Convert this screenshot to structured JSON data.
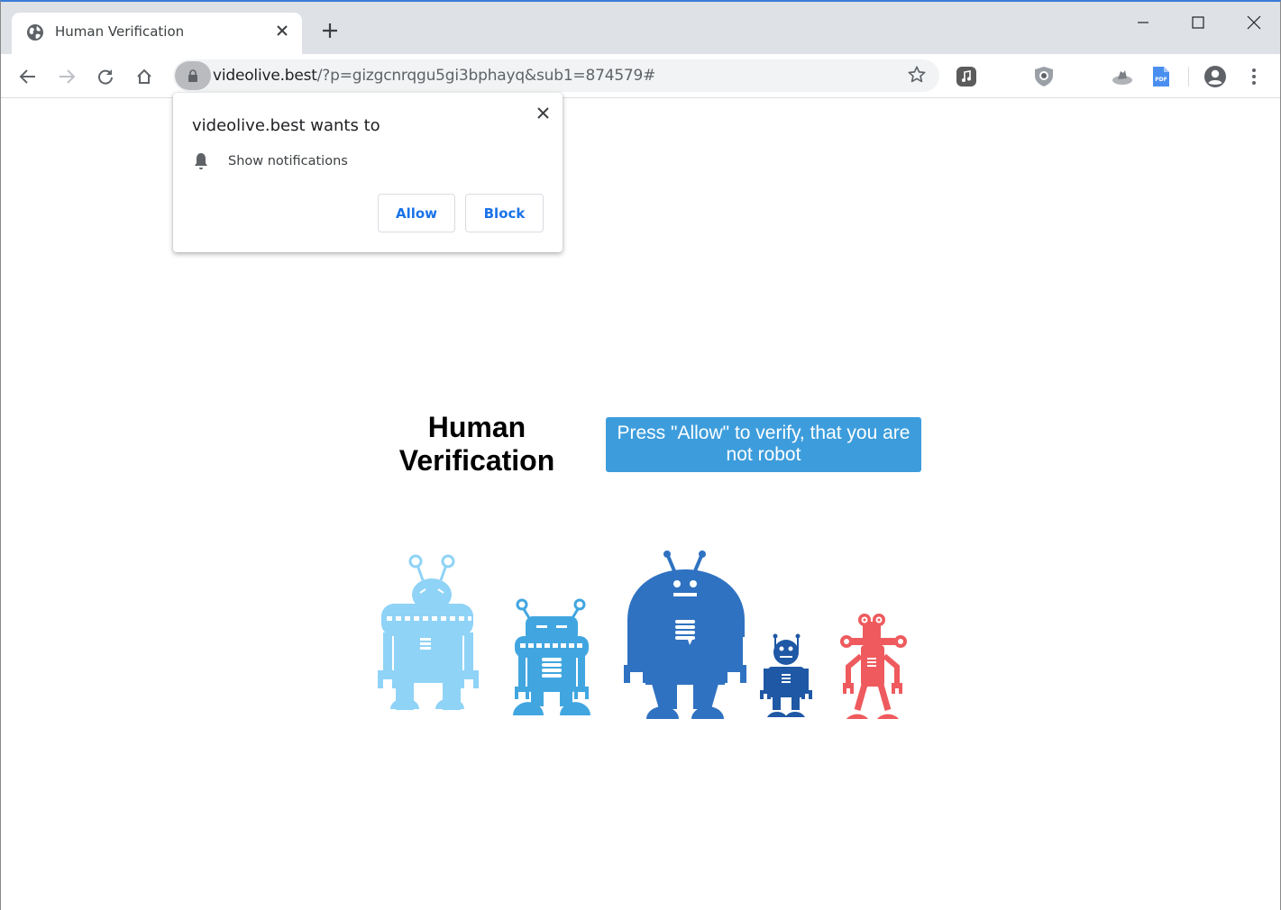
{
  "browser": {
    "tab": {
      "title": "Human Verification",
      "favicon": "globe-icon",
      "close_icon": "close-icon"
    },
    "new_tab_icon": "plus-icon",
    "window_controls": [
      "minimize-icon",
      "maximize-icon",
      "close-icon"
    ],
    "nav": {
      "back_icon": "arrow-left-icon",
      "forward_icon": "arrow-right-icon",
      "reload_icon": "reload-icon",
      "home_icon": "home-icon"
    },
    "omnibox": {
      "security_icon": "lock-icon",
      "url_host": "videolive.best",
      "url_rest": "/?p=gizgcnrqgu5gi3bphayq&sub1=874579#",
      "bookmark_icon": "star-icon"
    },
    "extensions": [
      "music-icon",
      "shield-search-icon",
      "cloud-icon",
      "pdf-icon"
    ],
    "profile_icon": "account-circle-icon",
    "menu_icon": "more-vert-icon"
  },
  "permission_prompt": {
    "title": "videolive.best wants to",
    "permission_icon": "bell-icon",
    "permission_label": "Show notifications",
    "allow_label": "Allow",
    "block_label": "Block"
  },
  "page": {
    "heading_line1": "Human",
    "heading_line2": "Verification",
    "banner_text": "Press \"Allow\" to verify, that you are not robot",
    "banner_color": "#3d9ddc",
    "robots": [
      {
        "name": "light-blue-robot",
        "color": "#8fd3f7"
      },
      {
        "name": "sky-blue-robot",
        "color": "#41a6e0"
      },
      {
        "name": "blue-robot",
        "color": "#2f72c1"
      },
      {
        "name": "navy-robot",
        "color": "#1f58a5"
      },
      {
        "name": "red-robot",
        "color": "#ee5a5d"
      }
    ]
  }
}
